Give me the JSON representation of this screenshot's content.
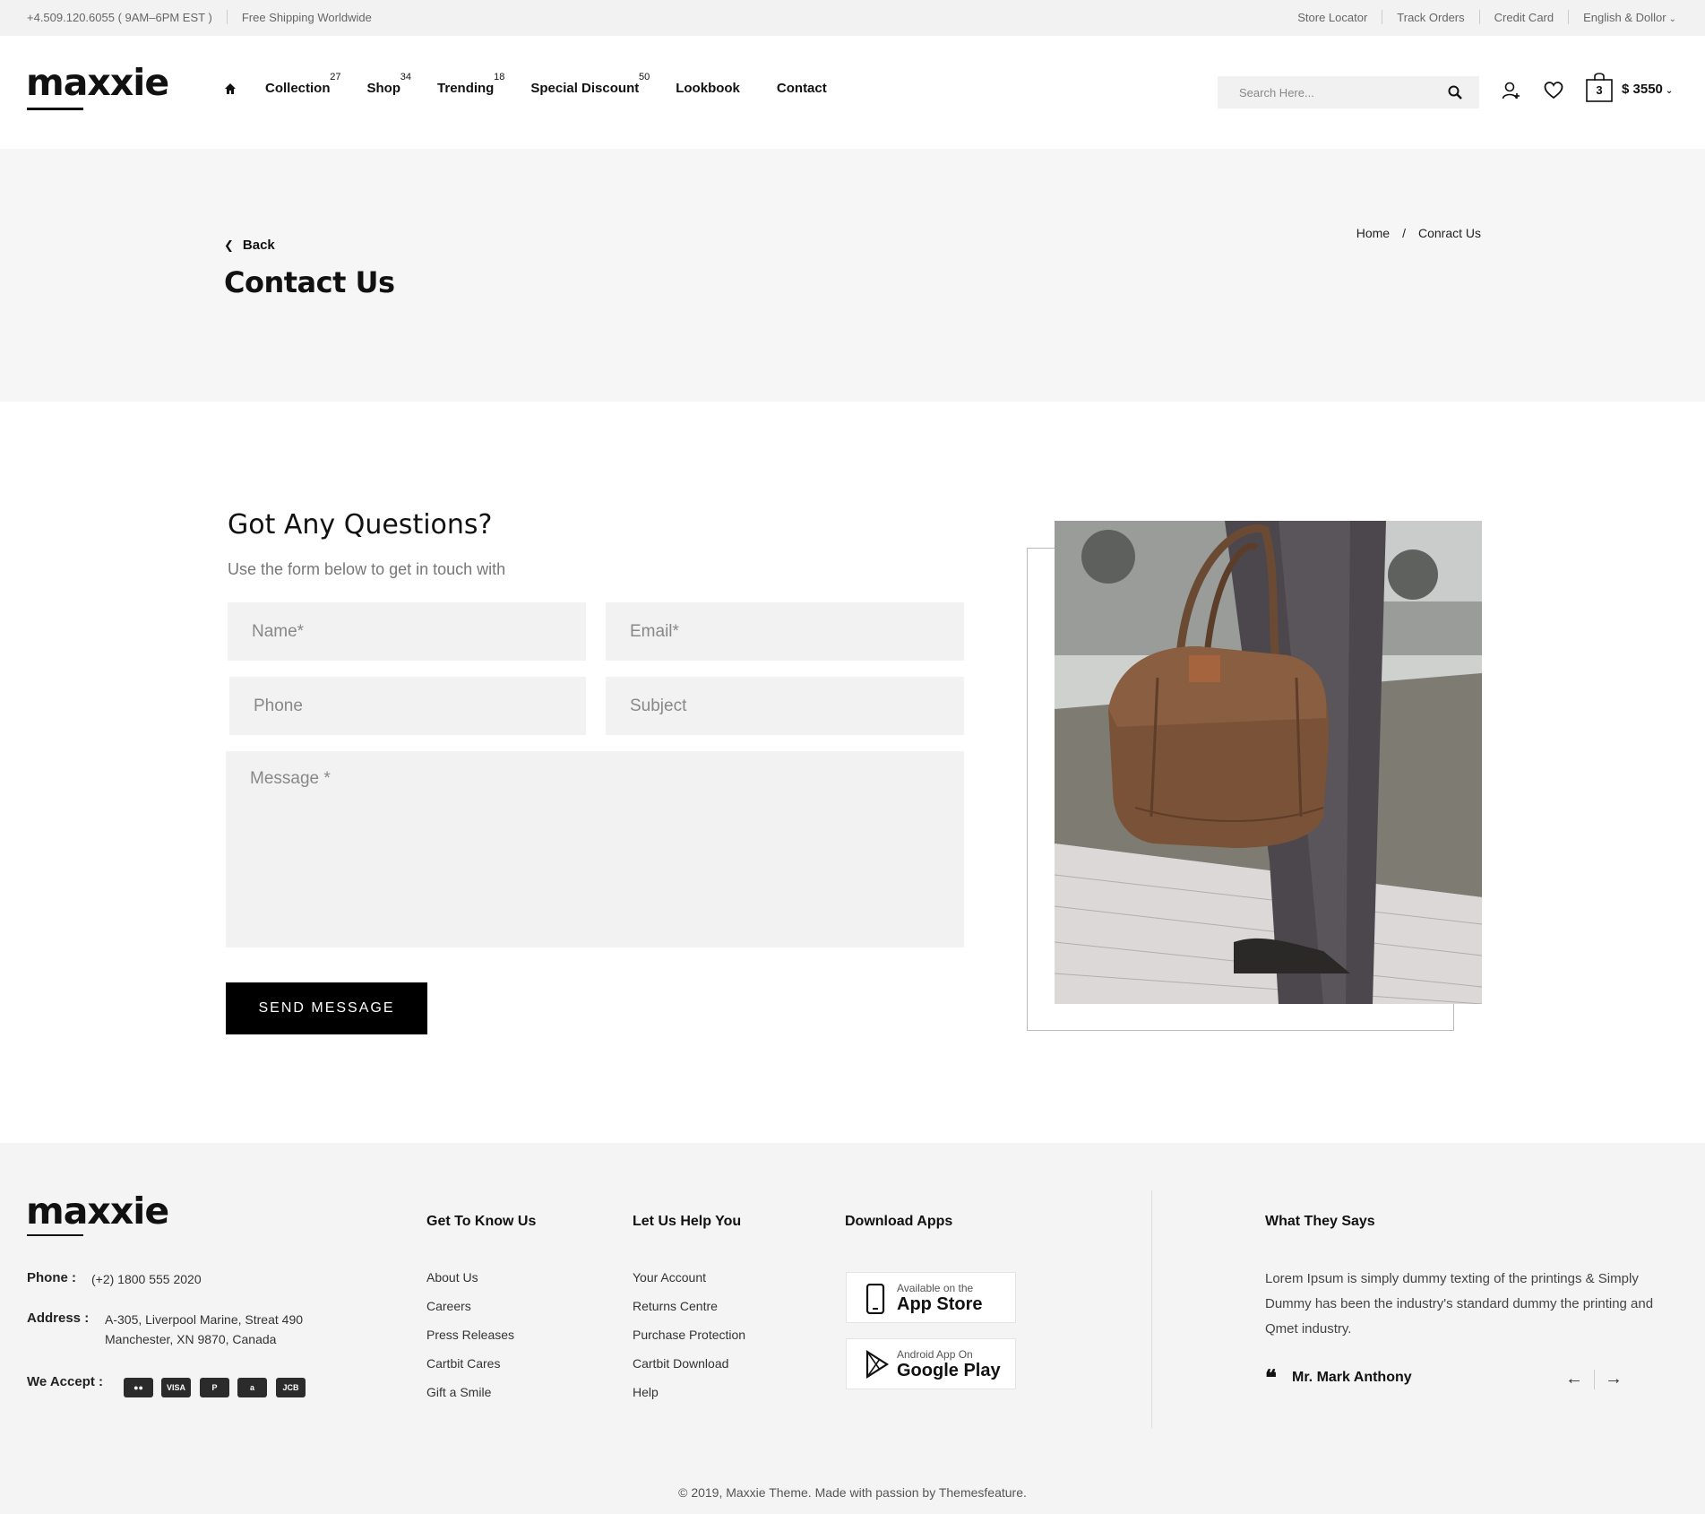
{
  "topbar": {
    "phone": "+4.509.120.6055 ( 9AM–6PM EST )",
    "shipping": "Free Shipping Worldwide",
    "links": [
      "Store Locator",
      "Track Orders",
      "Credit Card"
    ],
    "language": "English & Dollor"
  },
  "header": {
    "logo": "maxxie",
    "nav": [
      {
        "label": "Collection",
        "count": "27"
      },
      {
        "label": "Shop",
        "count": "34"
      },
      {
        "label": "Trending",
        "count": "18"
      },
      {
        "label": "Special Discount",
        "count": "50"
      },
      {
        "label": "Lookbook",
        "count": ""
      },
      {
        "label": "Contact",
        "count": ""
      }
    ],
    "search_placeholder": "Search Here...",
    "cart_count": "3",
    "cart_total": "$ 3550"
  },
  "page": {
    "back_label": "Back",
    "title": "Contact Us",
    "breadcrumb": [
      "Home",
      "Conract Us"
    ]
  },
  "contact": {
    "heading": "Got Any Questions?",
    "subheading": "Use the form below to get in touch with",
    "name_placeholder": "Name*",
    "email_placeholder": "Email*",
    "phone_placeholder": "Phone",
    "subject_placeholder": "Subject",
    "message_placeholder": "Message *",
    "submit_label": "SEND MESSAGE"
  },
  "footer": {
    "logo": "maxxie",
    "phone_label": "Phone :",
    "phone_value": "(+2) 1800 555 2020",
    "address_label": "Address :",
    "address_line1": "A-305, Liverpool Marine, Streat 490",
    "address_line2": "Manchester, XN 9870, Canada",
    "accept_label": "We Accept :",
    "payment_icons": [
      "mastercard-icon",
      "visa-icon",
      "paypal-icon",
      "amazon-icon",
      "jcb-icon"
    ],
    "col1": {
      "title": "Get To Know Us",
      "links": [
        "About Us",
        "Careers",
        "Press Releases",
        "Cartbit Cares",
        "Gift a Smile"
      ]
    },
    "col2": {
      "title": "Let Us Help You",
      "links": [
        "Your Account",
        "Returns Centre",
        "Purchase Protection",
        "Cartbit Download",
        "Help"
      ]
    },
    "apps": {
      "title": "Download Apps",
      "appstore_small": "Available on the",
      "appstore_big": "App Store",
      "play_small": "Android App On",
      "play_big": "Google Play"
    },
    "testimonial": {
      "title": "What They Says",
      "text": "Lorem Ipsum is simply dummy texting of the printings & Simply Dummy has been the industry's standard dummy the printing and Qmet industry.",
      "author": "Mr. Mark Anthony"
    },
    "copyright": "© 2019, Maxxie Theme. Made with passion by Themesfeature."
  }
}
